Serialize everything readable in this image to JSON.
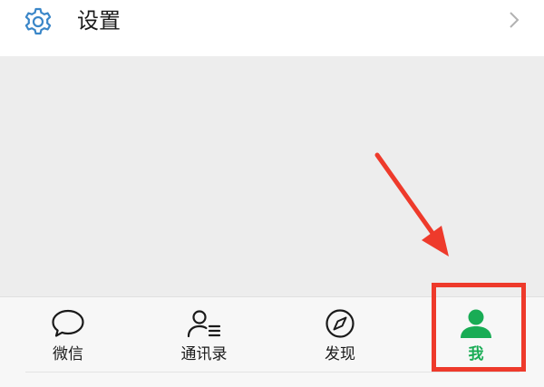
{
  "settings_row": {
    "label": "设置",
    "icon": "gear-icon",
    "chevron_icon": "chevron-right-icon"
  },
  "tabs": [
    {
      "label": "微信",
      "icon": "chat-bubble-icon",
      "active": false
    },
    {
      "label": "通讯录",
      "icon": "contacts-icon",
      "active": false
    },
    {
      "label": "发现",
      "icon": "compass-icon",
      "active": false
    },
    {
      "label": "我",
      "icon": "person-icon",
      "active": true
    }
  ],
  "annotation": {
    "arrow_icon": "arrow-icon",
    "highlight": "tab-me"
  },
  "colors": {
    "active_tab": "#19ac55",
    "inactive_tab": "#1a1a1a",
    "settings_icon": "#3a86c8",
    "annotation": "#ee3a2b",
    "background": "#ededed",
    "tab_bar_bg": "#f7f7f7"
  }
}
